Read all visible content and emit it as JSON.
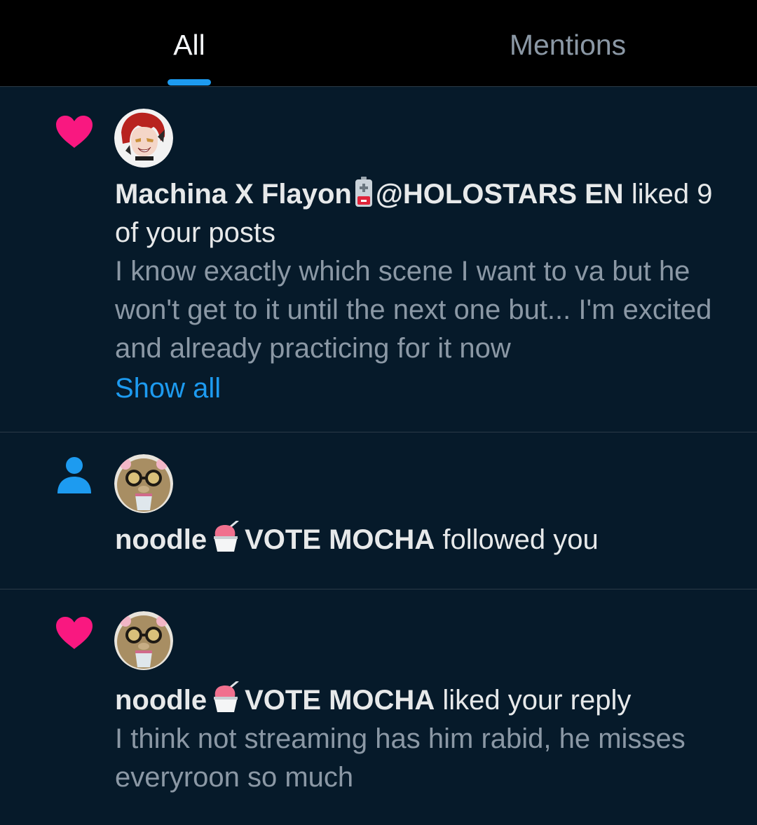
{
  "tabs": {
    "all": "All",
    "mentions": "Mentions"
  },
  "colors": {
    "accent": "#1d9bf0",
    "heart": "#f91880",
    "background": "#061a2a"
  },
  "notifications": [
    {
      "type_icon": "heart-icon",
      "avatar_icon": "anime-avatar",
      "name": "Machina X Flayon",
      "emoji_icon": "battery-icon",
      "name_suffix": "@HOLOSTARS EN",
      "action": "liked 9 of your posts",
      "preview": "I know exactly which scene I want to va but he won't get to it until the next one but... I'm excited and already practicing for it now",
      "show_all": "Show all"
    },
    {
      "type_icon": "person-icon",
      "avatar_icon": "bear-avatar",
      "name": "noodle",
      "emoji_icon": "shaved-ice-icon",
      "name_suffix": "VOTE MOCHA",
      "action": "followed you"
    },
    {
      "type_icon": "heart-icon",
      "avatar_icon": "bear-avatar",
      "name": "noodle",
      "emoji_icon": "shaved-ice-icon",
      "name_suffix": "VOTE MOCHA",
      "action": "liked your reply",
      "preview": "I think not streaming has him rabid, he misses everyroon so much"
    }
  ]
}
